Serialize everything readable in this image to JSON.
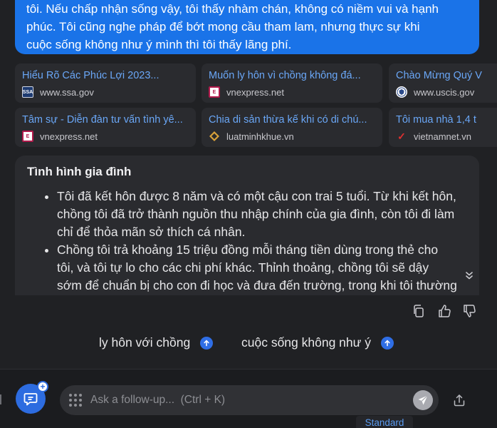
{
  "user_message": {
    "lines": [
      "tôi. Nếu chấp nhận sống vậy, tôi thấy nhàm chán, không có niềm vui và hạnh",
      "phúc. Tôi cũng nghe pháp để bớt mong cầu tham lam, nhưng thực sự khi",
      "cuộc sống không như ý mình thì tôi thấy lãng phí."
    ]
  },
  "sources": [
    {
      "title": "Hiểu Rõ Các Phúc Lợi 2023...",
      "site": "www.ssa.gov",
      "icon": "ssa-logo-icon",
      "fav_text": "SSA"
    },
    {
      "title": "Muốn ly hôn vì chồng không đá...",
      "site": "vnexpress.net",
      "icon": "vnexpress-logo-icon",
      "fav_text": "E"
    },
    {
      "title": "Chào Mừng Quý V",
      "site": "www.uscis.gov",
      "icon": "uscis-seal-icon",
      "fav_text": ""
    },
    {
      "title": "Tâm sự - Diễn đàn tư vấn tình yê...",
      "site": "vnexpress.net",
      "icon": "vnexpress-logo-icon",
      "fav_text": "E"
    },
    {
      "title": "Chia di sản thừa kế khi có di chú...",
      "site": "luatminhkhue.vn",
      "icon": "luatminhkhue-logo-icon",
      "fav_text": ""
    },
    {
      "title": "Tôi mua nhà 1,4 t",
      "site": "vietnamnet.vn",
      "icon": "vietnamnet-logo-icon",
      "fav_text": "✓"
    }
  ],
  "answer": {
    "heading": "Tình hình gia đình",
    "bullets": [
      {
        "lines": [
          "Tôi đã kết hôn được 8 năm và có một cậu con trai 5 tuổi. Từ khi kết hôn,",
          "chồng tôi đã trở thành nguồn thu nhập chính của gia đình, còn tôi đi làm",
          "chỉ để thỏa mãn sở thích cá nhân."
        ]
      },
      {
        "lines": [
          "Chồng tôi trả khoảng 15 triệu đồng mỗi tháng tiền dùng trong thẻ cho",
          "tôi, và tôi tự lo cho các chi phí khác. Thỉnh thoảng, chồng tôi sẽ dậy",
          "sớm để chuẩn bị cho con đi học và đưa đến trường, trong khi tôi thường"
        ]
      }
    ]
  },
  "actions": [
    "copy-icon",
    "thumbs-up-icon",
    "thumbs-down-icon"
  ],
  "suggestions": [
    "ly hôn với chồng",
    "cuộc sống không như ý"
  ],
  "composer": {
    "placeholder": "Ask a follow-up...  (Ctrl + K)",
    "mode_label": "Standard"
  },
  "colors": {
    "background": "#202124",
    "user_bubble": "#1a73e8",
    "link": "#6aa7f7",
    "accent": "#2f6ee6"
  }
}
